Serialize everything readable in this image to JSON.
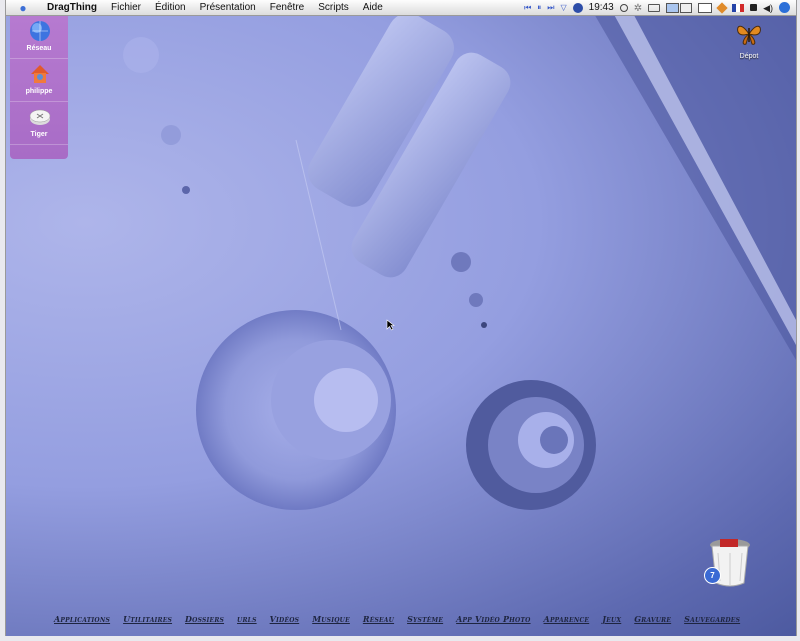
{
  "menubar": {
    "app_name": "DragThing",
    "menus": [
      "Fichier",
      "Édition",
      "Présentation",
      "Fenêtre",
      "Scripts",
      "Aide"
    ],
    "clock": "19:43",
    "icons": [
      "apple-icon",
      "rewind-icon",
      "pause-icon",
      "forward-icon",
      "eject-icon",
      "globe-icon",
      "search-magnifier-icon",
      "gear-icon",
      "battery-icon",
      "screen-icon",
      "window-icon",
      "drive-icon",
      "flag-icon",
      "lock-icon",
      "volume-icon",
      "spotlight-icon"
    ],
    "accent": "#3d6fd6"
  },
  "drawer": {
    "items": [
      {
        "label": "Réseau",
        "icon": "network-globe-icon"
      },
      {
        "label": "philippe",
        "icon": "home-icon"
      },
      {
        "label": "Tiger",
        "icon": "disk-icon"
      }
    ],
    "color": "#b07ccc"
  },
  "desktop": {
    "depot_label": "Dépot",
    "trash_badge": "7"
  },
  "tabs": [
    "Applications",
    "Utilitaires",
    "Dossiers",
    "urls",
    "Vidéos",
    "Musique",
    "Réseau",
    "Système",
    "App Vidéo Photo",
    "Apparence",
    "Jeux",
    "Gravure",
    "Sauvegardes"
  ]
}
